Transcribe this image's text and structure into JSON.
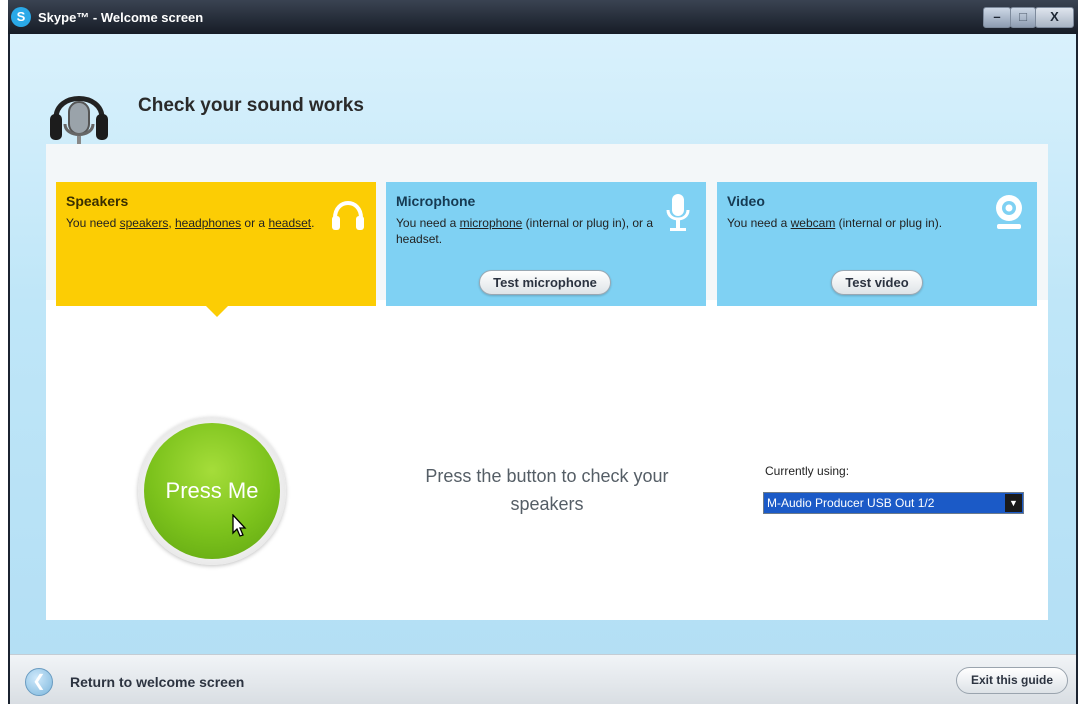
{
  "window": {
    "title": "Skype™ - Welcome screen",
    "app_icon_letter": "S",
    "controls": {
      "minimize": "–",
      "maximize": "□",
      "close": "X"
    }
  },
  "header": {
    "title": "Check your sound works",
    "icon": "headset-mic-icon"
  },
  "cards": {
    "speakers": {
      "title": "Speakers",
      "desc_prefix": "You need ",
      "link1": "speakers",
      "sep1": ", ",
      "link2": "headphones",
      "sep2": " or a ",
      "link3": "headset",
      "desc_suffix": ".",
      "icon": "headphones-icon"
    },
    "microphone": {
      "title": "Microphone",
      "desc_prefix": "You need a ",
      "link": "microphone",
      "desc_suffix": " (internal or plug in), or a headset.",
      "button": "Test microphone",
      "icon": "microphone-icon"
    },
    "video": {
      "title": "Video",
      "desc_prefix": "You need a ",
      "link": "webcam",
      "desc_suffix": " (internal or plug in).",
      "button": "Test video",
      "icon": "webcam-icon"
    }
  },
  "speakers_test": {
    "button_label": "Press Me",
    "instruction": "Press the button to check your speakers",
    "device_label": "Currently using:",
    "device_selected": "M-Audio Producer USB Out 1/2"
  },
  "footer": {
    "back_label": "Return to welcome screen",
    "exit_label": "Exit this guide"
  },
  "colors": {
    "speakers_card": "#fccd04",
    "other_cards": "#7fd1f3",
    "press_button": "#7cc21c",
    "select_highlight": "#1b5ac7"
  }
}
